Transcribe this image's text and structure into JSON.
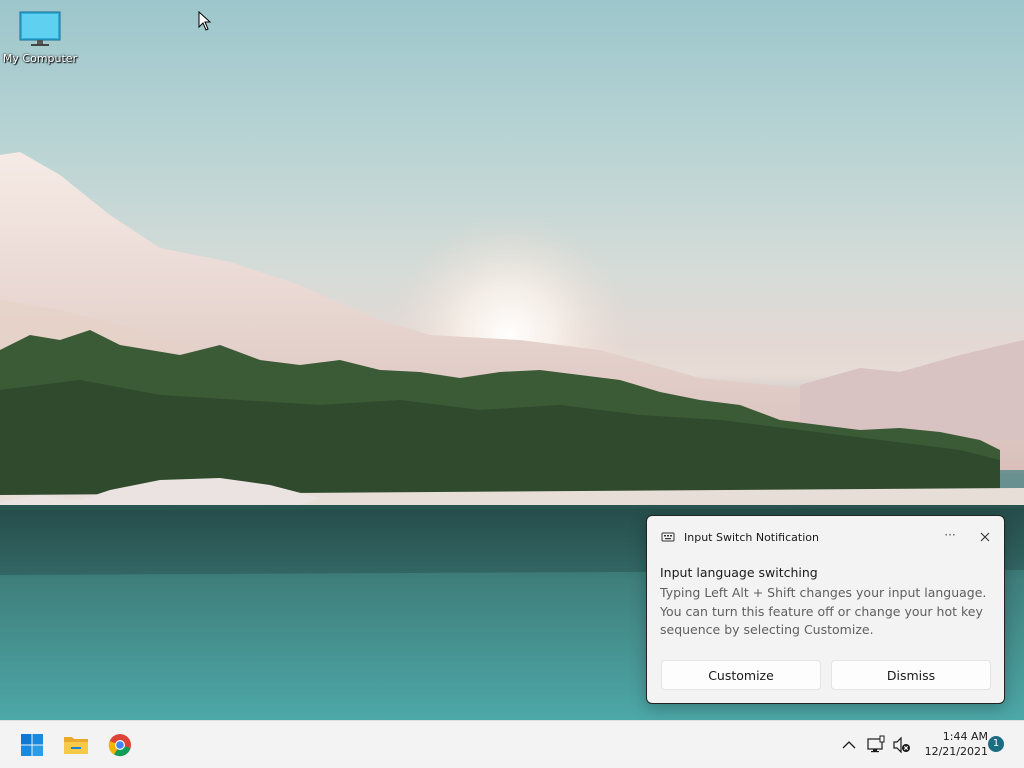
{
  "desktop": {
    "icons": [
      {
        "label": "My Computer",
        "icon": "monitor-icon"
      }
    ]
  },
  "notification": {
    "app_name": "Input Switch Notification",
    "more_label": "···",
    "title": "Input language switching",
    "body": "Typing Left Alt + Shift changes your input language. You can turn this feature off or change your hot key sequence by selecting Customize.",
    "buttons": {
      "customize": "Customize",
      "dismiss": "Dismiss"
    }
  },
  "taskbar": {
    "pinned": [
      "windows-start-icon",
      "file-explorer-icon",
      "chrome-icon"
    ],
    "tray": {
      "time": "1:44 AM",
      "date": "12/21/2021",
      "notification_count": "1"
    },
    "accent_color": "#1a6e82"
  }
}
